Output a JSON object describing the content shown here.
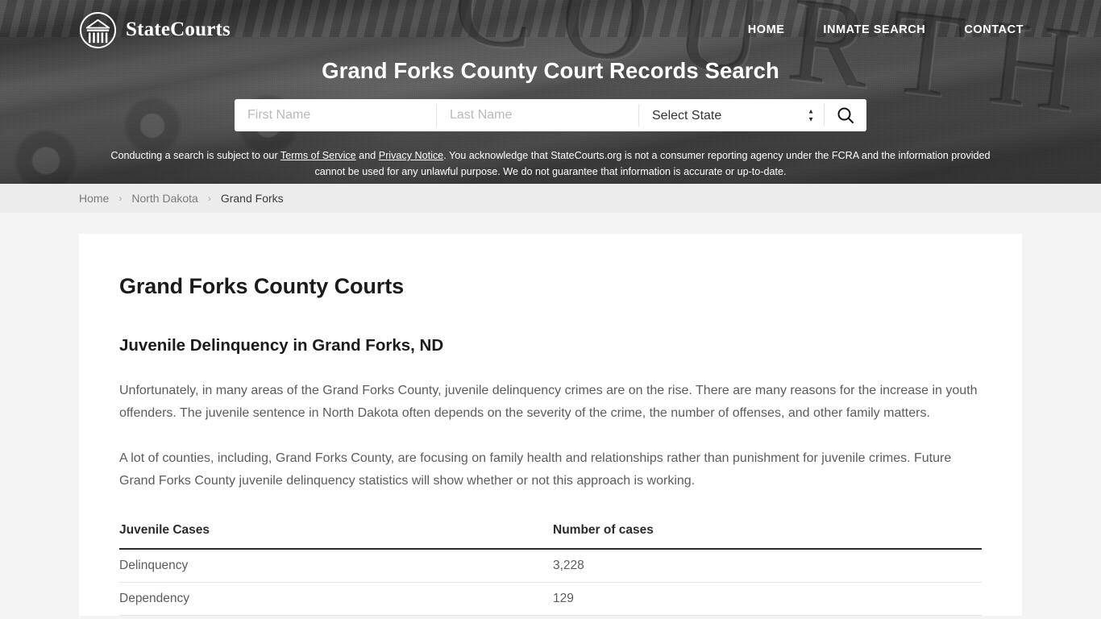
{
  "header": {
    "brand_name": "StateCourts",
    "logo_icon": "courthouse-logo-icon",
    "nav": [
      {
        "label": "HOME"
      },
      {
        "label": "INMATE SEARCH"
      },
      {
        "label": "CONTACT"
      }
    ],
    "title": "Grand Forks County Court Records Search",
    "engraving_text": "COURTHOUSE"
  },
  "search": {
    "first_name_placeholder": "First Name",
    "first_name_value": "",
    "last_name_placeholder": "Last Name",
    "last_name_value": "",
    "state_selected": "Select State",
    "state_options": [
      "Select State"
    ],
    "submit_icon": "search-icon",
    "dropdown_icon": "chevron-updown-icon"
  },
  "disclaimer": {
    "part1": "Conducting a search is subject to our ",
    "link_terms": "Terms of Service",
    "part2": " and ",
    "link_privacy": "Privacy Notice",
    "part3": ". You acknowledge that StateCourts.org is not a consumer reporting agency under the FCRA and the information provided cannot be used for any unlawful purpose. We do not guarantee that information is accurate or up-to-date."
  },
  "breadcrumb": {
    "items": [
      {
        "label": "Home",
        "current": false
      },
      {
        "label": "North Dakota",
        "current": false
      },
      {
        "label": "Grand Forks",
        "current": true
      }
    ],
    "separator": "›"
  },
  "main": {
    "page_title": "Grand Forks County Courts",
    "section_heading": "Juvenile Delinquency in Grand Forks, ND",
    "paragraph_1": "Unfortunately, in many areas of the Grand Forks County, juvenile delinquency crimes are on the rise. There are many reasons for the increase in youth offenders. The juvenile sentence in North Dakota often depends on the severity of the crime, the number of offenses, and other family matters.",
    "paragraph_2": "A lot of counties, including, Grand Forks County, are focusing on family health and relationships rather than punishment for juvenile crimes. Future Grand Forks County juvenile delinquency statistics will show whether or not this approach is working.",
    "table": {
      "columns": [
        "Juvenile Cases",
        "Number of cases"
      ],
      "rows": [
        [
          "Delinquency",
          "3,228"
        ],
        [
          "Dependency",
          "129"
        ]
      ]
    }
  },
  "colors": {
    "hero_overlay": "#2b2b2b",
    "breadcrumb_bg": "#ececec",
    "page_bg": "#f4f4f4",
    "card_bg": "#ffffff",
    "text_body": "#5c5c5c",
    "text_heading": "#1b1b1b"
  }
}
